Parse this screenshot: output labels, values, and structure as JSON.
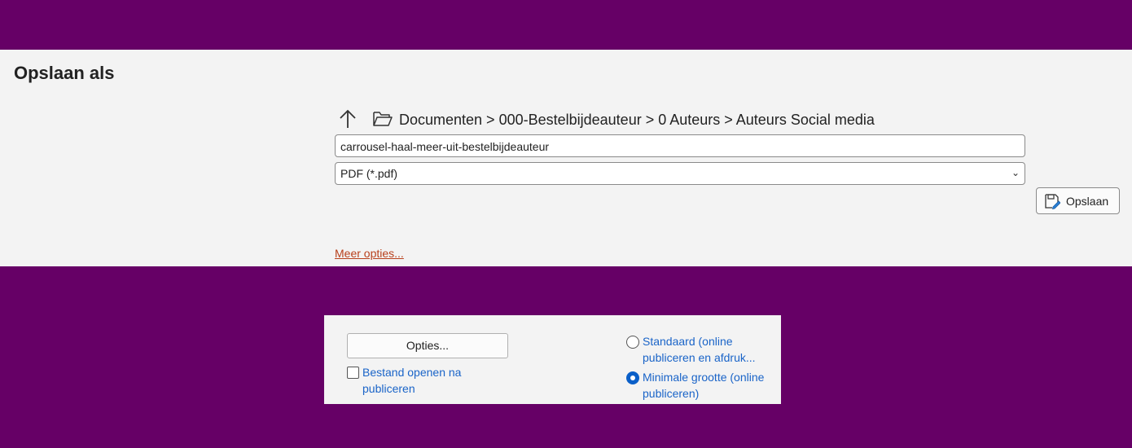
{
  "dialog": {
    "title": "Opslaan als",
    "breadcrumb": "Documenten > 000-Bestelbijdeauteur > 0 Auteurs > Auteurs Social media",
    "filename": "carrousel-haal-meer-uit-bestelbijdeauteur",
    "filetype": "PDF (*.pdf)",
    "save_label": "Opslaan",
    "more_options": "Meer opties..."
  },
  "options_panel": {
    "options_button": "Opties...",
    "open_after_publish": {
      "label": "Bestand openen na publiceren",
      "checked": false
    },
    "optimize": [
      {
        "label": "Standaard (online publiceren en afdruk...",
        "selected": false
      },
      {
        "label": "Minimale grootte (online publiceren)",
        "selected": true
      }
    ]
  },
  "colors": {
    "background": "#660066",
    "panel": "#f3f3f3",
    "link": "#b8401c",
    "accent": "#0a5fc8"
  }
}
